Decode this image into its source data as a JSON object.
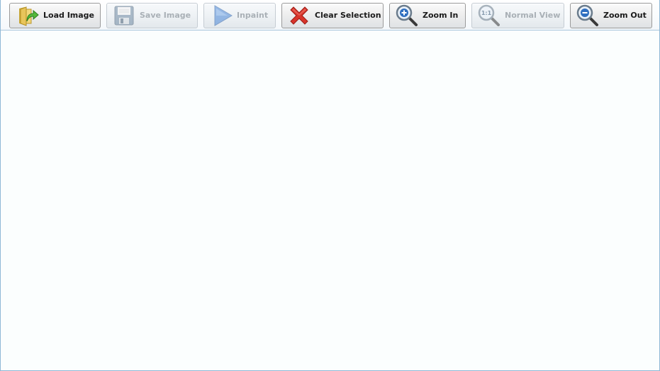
{
  "toolbar": {
    "load_image": {
      "label": "Load Image",
      "icon": "folder-arrow-icon",
      "enabled": true
    },
    "save_image": {
      "label": "Save Image",
      "icon": "floppy-disk-icon",
      "enabled": false
    },
    "inpaint": {
      "label": "Inpaint",
      "icon": "play-triangle-icon",
      "enabled": false
    },
    "clear_selection": {
      "label": "Clear Selection",
      "icon": "red-x-icon",
      "enabled": true
    },
    "zoom_in": {
      "label": "Zoom In",
      "icon": "magnifier-plus-icon",
      "enabled": true
    },
    "normal_view": {
      "label": "Normal View",
      "icon": "magnifier-1to1-icon",
      "icon_text": "1:1",
      "enabled": false
    },
    "zoom_out": {
      "label": "Zoom Out",
      "icon": "magnifier-minus-icon",
      "enabled": true
    }
  },
  "colors": {
    "frame_border": "#8fb8d6",
    "canvas_background": "#fbfefe",
    "disabled_text": "#a9b0b6",
    "enabled_text": "#1a1a1a"
  }
}
